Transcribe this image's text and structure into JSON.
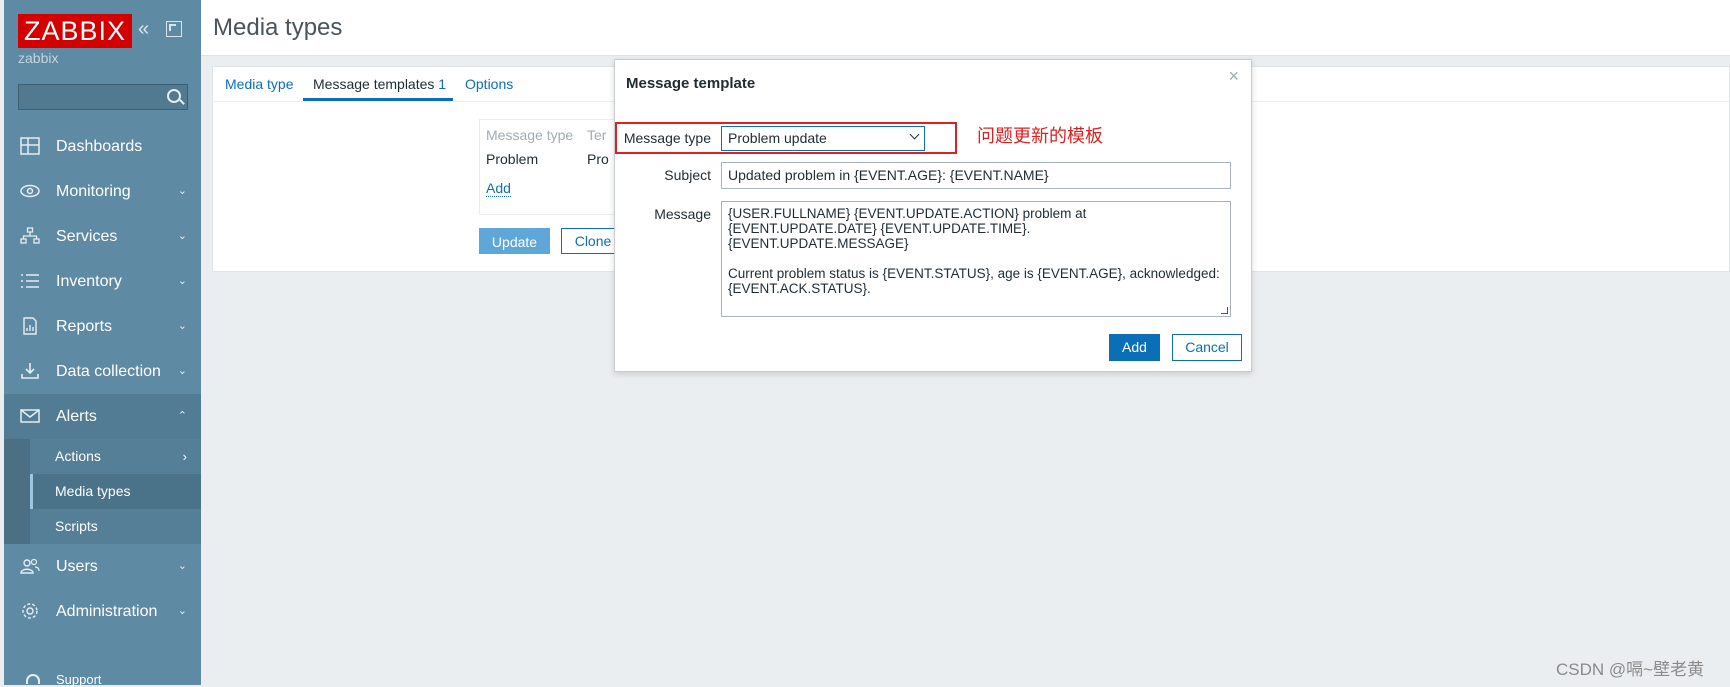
{
  "app": {
    "logo": "ZABBIX",
    "server_name": "zabbix"
  },
  "sidebar": {
    "search_placeholder": "",
    "items": [
      {
        "label": "Dashboards",
        "icon": "dashboard-icon",
        "chevron": ""
      },
      {
        "label": "Monitoring",
        "icon": "eye-icon",
        "chevron": "⌄"
      },
      {
        "label": "Services",
        "icon": "services-icon",
        "chevron": "⌄"
      },
      {
        "label": "Inventory",
        "icon": "list-icon",
        "chevron": "⌄"
      },
      {
        "label": "Reports",
        "icon": "report-icon",
        "chevron": "⌄"
      },
      {
        "label": "Data collection",
        "icon": "download-icon",
        "chevron": "⌄"
      },
      {
        "label": "Alerts",
        "icon": "envelope-icon",
        "chevron": "⌃"
      }
    ],
    "alerts_sub": [
      {
        "label": "Actions",
        "chevron": "›"
      },
      {
        "label": "Media types",
        "chevron": ""
      },
      {
        "label": "Scripts",
        "chevron": ""
      }
    ],
    "items_after": [
      {
        "label": "Users",
        "icon": "users-icon",
        "chevron": "⌄"
      },
      {
        "label": "Administration",
        "icon": "gear-icon",
        "chevron": "⌄"
      }
    ],
    "support": "Support"
  },
  "page": {
    "title": "Media types"
  },
  "tabs": {
    "media_type": "Media type",
    "message_templates": "Message templates",
    "message_templates_count": "1",
    "options": "Options"
  },
  "templates_table": {
    "headers": [
      "Message type",
      "Ter"
    ],
    "row": [
      "Problem",
      "Pro"
    ],
    "add": "Add"
  },
  "form_buttons": {
    "update": "Update",
    "clone": "Clone"
  },
  "dialog": {
    "title": "Message template",
    "close": "×",
    "message_type_label": "Message type",
    "message_type_value": "Problem update",
    "subject_label": "Subject",
    "subject_value": "Updated problem in {EVENT.AGE}: {EVENT.NAME}",
    "message_label": "Message",
    "message_value": "{USER.FULLNAME} {EVENT.UPDATE.ACTION} problem at\n{EVENT.UPDATE.DATE} {EVENT.UPDATE.TIME}.\n{EVENT.UPDATE.MESSAGE}\n\nCurrent problem status is {EVENT.STATUS}, age is {EVENT.AGE}, acknowledged:\n{EVENT.ACK.STATUS}.",
    "add": "Add",
    "cancel": "Cancel"
  },
  "annotation": "问题更新的模板",
  "watermark": "CSDN @嗝~壁老黄"
}
